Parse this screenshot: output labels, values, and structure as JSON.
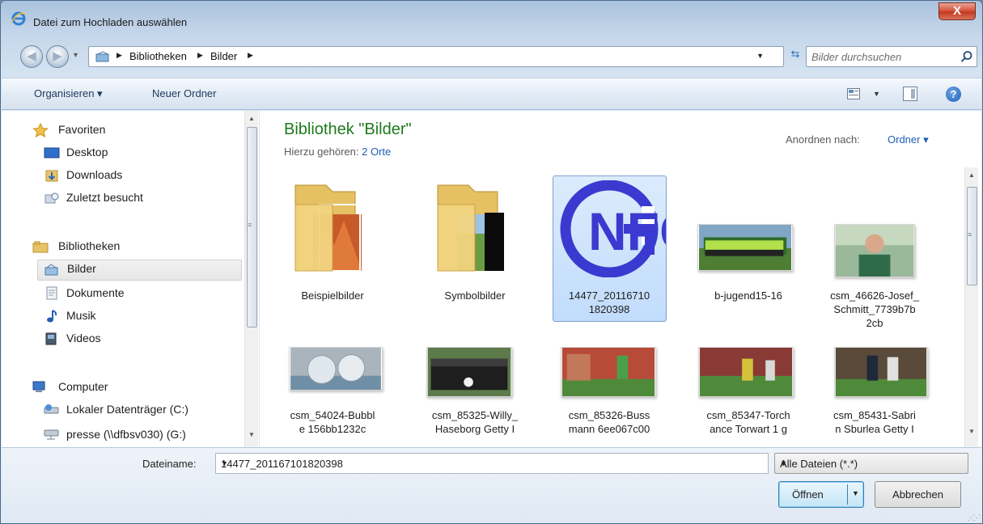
{
  "window": {
    "title": "Datei zum Hochladen auswählen",
    "close": "X"
  },
  "address": {
    "crumbs": [
      "Bibliotheken",
      "Bilder"
    ],
    "search_placeholder": "Bilder durchsuchen"
  },
  "toolbar": {
    "organize": "Organisieren ▾",
    "new_folder": "Neuer Ordner",
    "help": "?"
  },
  "nav": {
    "favorites": "Favoriten",
    "desktop": "Desktop",
    "downloads": "Downloads",
    "recent": "Zuletzt besucht",
    "libraries": "Bibliotheken",
    "pictures": "Bilder",
    "documents": "Dokumente",
    "music": "Musik",
    "videos": "Videos",
    "computer": "Computer",
    "local_disk": "Lokaler Datenträger (C:)",
    "network": "presse (\\\\dfbsv030) (G:)"
  },
  "library": {
    "title": "Bibliothek \"Bilder\"",
    "sub_prefix": "Hierzu gehören:",
    "sub_link": "2 Orte",
    "arrange_label": "Anordnen nach:",
    "arrange_value": "Ordner ▾"
  },
  "items": [
    {
      "line1": "Beispielbilder",
      "line2": "",
      "line3": ""
    },
    {
      "line1": "Symbolbilder",
      "line2": "",
      "line3": ""
    },
    {
      "line1": "14477_20116710",
      "line2": "1820398",
      "line3": ""
    },
    {
      "line1": "b-jugend15-16",
      "line2": "",
      "line3": ""
    },
    {
      "line1": "csm_46626-Josef_",
      "line2": "Schmitt_7739b7b",
      "line3": "2cb"
    },
    {
      "line1": "csm_54024-Bubbl",
      "line2": "e 156bb1232c",
      "line3": ""
    },
    {
      "line1": "csm_85325-Willy_",
      "line2": "Haseborg Getty I",
      "line3": ""
    },
    {
      "line1": "csm_85326-Buss",
      "line2": "mann 6ee067c00",
      "line3": ""
    },
    {
      "line1": "csm_85347-Torch",
      "line2": "ance Torwart 1 g",
      "line3": ""
    },
    {
      "line1": "csm_85431-Sabri",
      "line2": "n Sburlea Getty I",
      "line3": ""
    }
  ],
  "logo_text": "NFG",
  "footer": {
    "filename_label": "Dateiname:",
    "filename_value": "14477_201167101820398",
    "filetype_value": "Alle Dateien (*.*)",
    "open": "Öffnen",
    "cancel": "Abbrechen"
  },
  "colors": {
    "library_title": "#1e7a1e",
    "link": "#1a5fb4",
    "selection": "#c1dcfc",
    "logo": "#3a3ad0"
  }
}
